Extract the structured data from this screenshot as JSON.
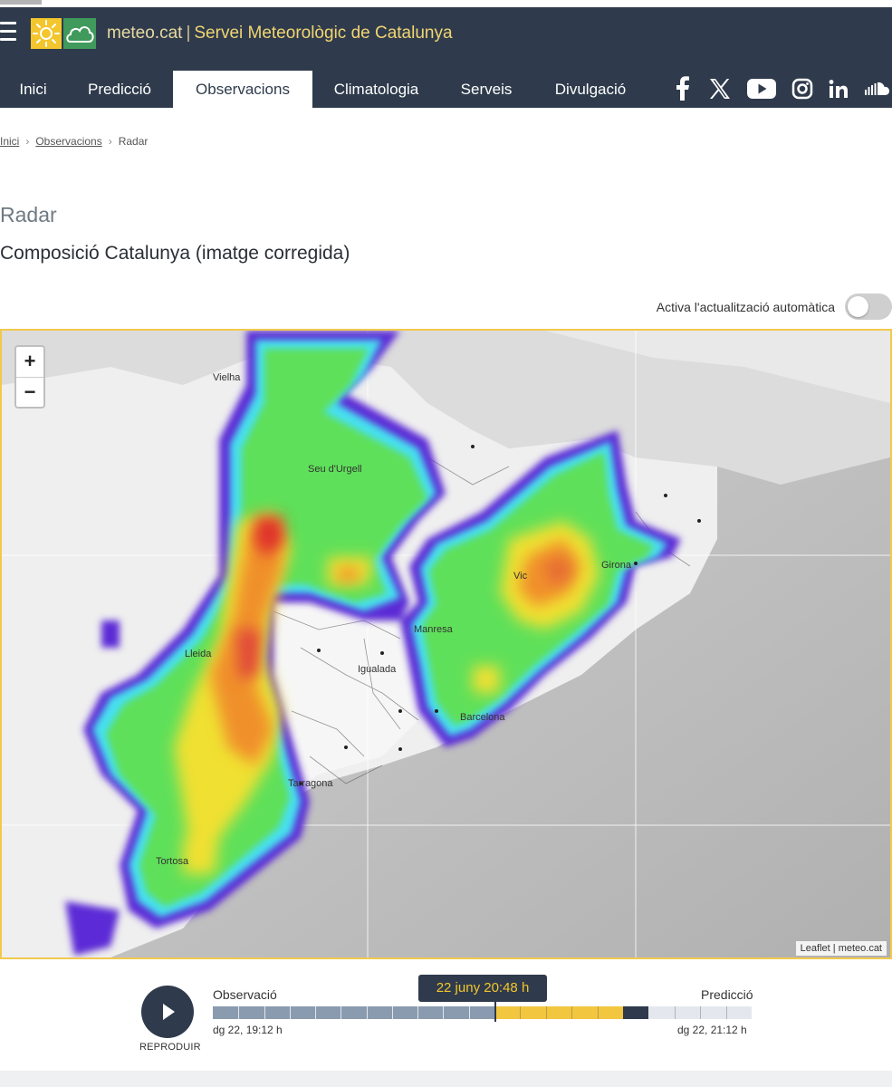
{
  "header": {
    "site": "meteo.cat",
    "separator": "|",
    "title": "Servei Meteorològic de Catalunya"
  },
  "nav": {
    "tabs": [
      {
        "label": "Inici"
      },
      {
        "label": "Predicció"
      },
      {
        "label": "Observacions",
        "active": true
      },
      {
        "label": "Climatologia"
      },
      {
        "label": "Serveis"
      },
      {
        "label": "Divulgació"
      }
    ],
    "social": [
      "facebook-icon",
      "x-icon",
      "youtube-icon",
      "instagram-icon",
      "linkedin-icon",
      "soundcloud-icon"
    ]
  },
  "breadcrumb": {
    "items": [
      "Inici",
      "Observacions",
      "Radar"
    ]
  },
  "page": {
    "title": "Radar",
    "subtitle": "Composició Catalunya (imatge corregida)",
    "autoupdate_label": "Activa l'actualització automàtica",
    "autoupdate_on": false
  },
  "map": {
    "zoom_in": "+",
    "zoom_out": "−",
    "attribution_leaflet": "Leaflet",
    "attribution_sep": "|",
    "attribution_meteo": "meteo.cat",
    "places": [
      "Vielha",
      "Seu d'Urgell",
      "Vic",
      "Girona",
      "Lleida",
      "Igualada",
      "Manresa",
      "Barcelona",
      "Tarragona",
      "Tortosa"
    ]
  },
  "timeline": {
    "play_label": "REPRODUIR",
    "observation_label": "Observació",
    "prediction_label": "Predicció",
    "start": "dg 22, 19:12 h",
    "end": "dg 22, 21:12 h",
    "current": "22 juny 20:48 h",
    "observation_steps": 11,
    "prediction_steps": 5,
    "colors": {
      "observation": "#8a9bb0",
      "prediction": "#f3c640",
      "current_marker": "#2f3b4c",
      "future": "#e4e8ee"
    }
  },
  "colors": {
    "header_bg": "#2f3b4c",
    "brand_text": "#f1d571",
    "map_border": "#f2c94c"
  }
}
